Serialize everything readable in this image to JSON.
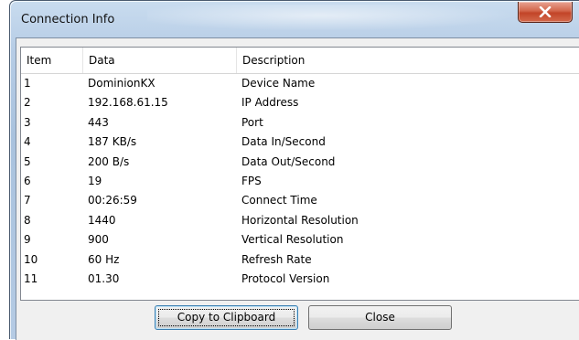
{
  "window": {
    "title": "Connection Info",
    "close_glyph": "close-x-icon"
  },
  "columns": [
    "Item",
    "Data",
    "Description"
  ],
  "rows": [
    {
      "item": "1",
      "data": "DominionKX",
      "description": "Device Name"
    },
    {
      "item": "2",
      "data": "192.168.61.15",
      "description": "IP Address"
    },
    {
      "item": "3",
      "data": "443",
      "description": "Port"
    },
    {
      "item": "4",
      "data": "187 KB/s",
      "description": "Data In/Second"
    },
    {
      "item": "5",
      "data": "200 B/s",
      "description": "Data Out/Second"
    },
    {
      "item": "6",
      "data": "19",
      "description": "FPS"
    },
    {
      "item": "7",
      "data": "00:26:59",
      "description": "Connect Time"
    },
    {
      "item": "8",
      "data": "1440",
      "description": "Horizontal Resolution"
    },
    {
      "item": "9",
      "data": "900",
      "description": "Vertical Resolution"
    },
    {
      "item": "10",
      "data": "60 Hz",
      "description": "Refresh Rate"
    },
    {
      "item": "11",
      "data": "01.30",
      "description": "Protocol Version"
    }
  ],
  "buttons": {
    "copy_label": "Copy to Clipboard",
    "close_label": "Close"
  },
  "colors": {
    "close_button": "#c24428",
    "default_button_border": "#3c7fb1"
  }
}
